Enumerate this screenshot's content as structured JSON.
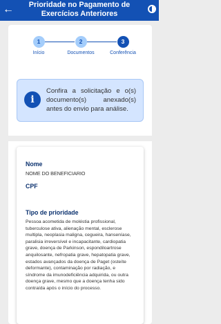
{
  "header": {
    "title": "Prioridade no Pagamento de Exercícios Anteriores"
  },
  "steps": [
    {
      "number": "1",
      "label": "Início"
    },
    {
      "number": "2",
      "label": "Documentos"
    },
    {
      "number": "3",
      "label": "Conferência"
    }
  ],
  "alert": {
    "text": "Confira a solicitação e o(s) documento(s) anexado(s) antes do envio para análise."
  },
  "details": {
    "name_label": "Nome",
    "name_value": "NOME DO BENEFICIARIO",
    "cpf_label": "CPF",
    "cpf_value": "",
    "priority_label": "Tipo de prioridade",
    "priority_value": "Pessoa acometida de moléstia profissional, tuberculose ativa, alienação mental, esclerose multipla, neoplasia maligna, cegueira, hanseníase, paralisia irreversível e incapacitante, cardiopatia grave, doença de Parkinson, espondiloartrose anquilosante, nefropatia grave, hepatopatia grave, estados avançados da doença de Paget (osteíte deformante), contaminação por radiação, e síndrome da imunodeficiência adquirida, ou outra doença grave, mesmo que a doença tenha sido contraída após o início do processo."
  }
}
